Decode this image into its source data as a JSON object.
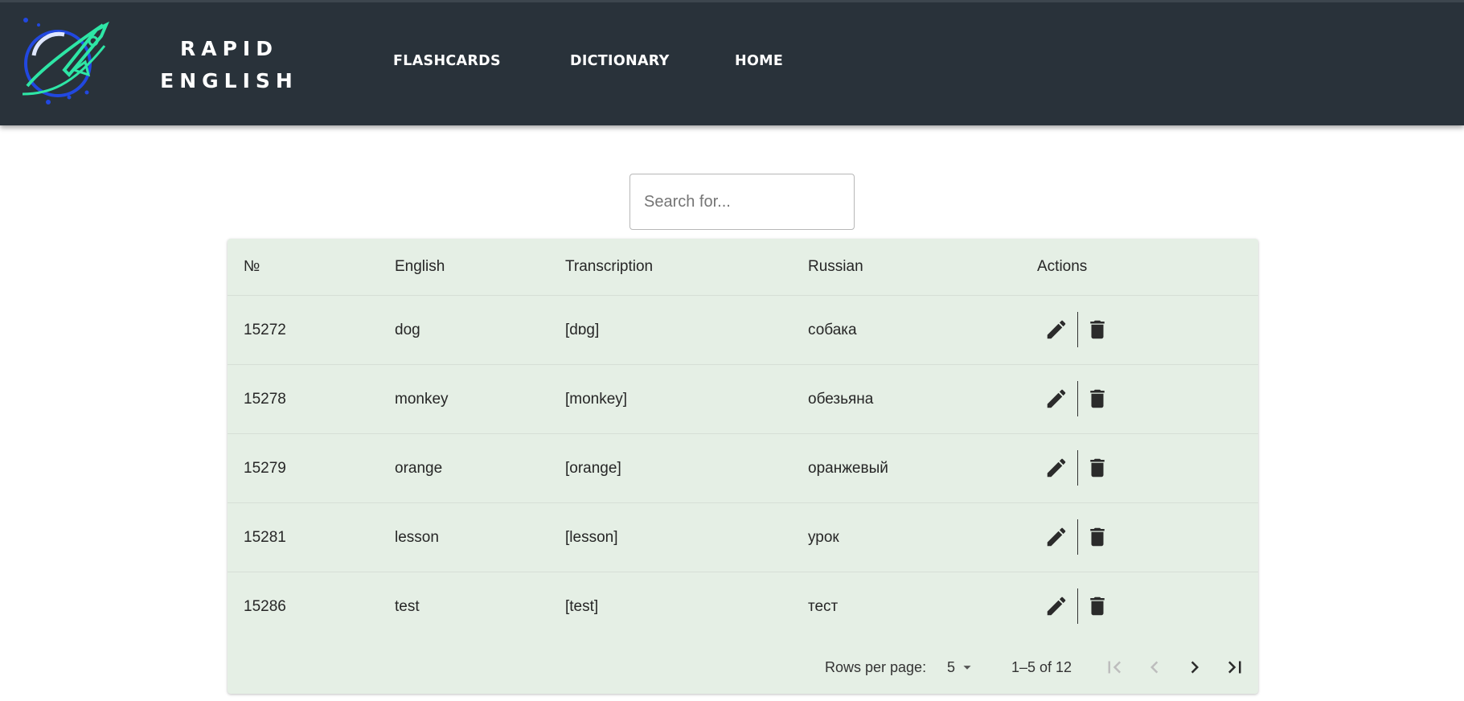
{
  "header": {
    "brand_line1": "RAPID",
    "brand_line2": "ENGLISH",
    "nav": [
      {
        "label": "FLASHCARDS"
      },
      {
        "label": "DICTIONARY"
      },
      {
        "label": "HOME"
      }
    ],
    "logo_icon": "rocket-planet-logo",
    "colors": {
      "bar": "#29323a",
      "logo_green": "#2ee6a6",
      "logo_blue": "#2148e0"
    }
  },
  "search": {
    "placeholder": "Search for...",
    "value": ""
  },
  "table": {
    "columns": [
      "№",
      "English",
      "Transcription",
      "Russian",
      "Actions"
    ],
    "rows": [
      {
        "id": "15272",
        "english": "dog",
        "transcription": "[dɒg]",
        "russian": "собака"
      },
      {
        "id": "15278",
        "english": "monkey",
        "transcription": "[monkey]",
        "russian": "обезьяна"
      },
      {
        "id": "15279",
        "english": "orange",
        "transcription": "[orange]",
        "russian": "оранжевый"
      },
      {
        "id": "15281",
        "english": "lesson",
        "transcription": "[lesson]",
        "russian": "урок"
      },
      {
        "id": "15286",
        "english": "test",
        "transcription": "[test]",
        "russian": "тест"
      }
    ],
    "action_icons": [
      "pencil-icon",
      "trash-icon"
    ],
    "background": "#e5efe5"
  },
  "pagination": {
    "rows_per_page_label": "Rows per page:",
    "rows_per_page": "5",
    "range": "1–5 of 12",
    "icons": [
      "first-page-icon",
      "previous-page-icon",
      "next-page-icon",
      "last-page-icon"
    ]
  }
}
